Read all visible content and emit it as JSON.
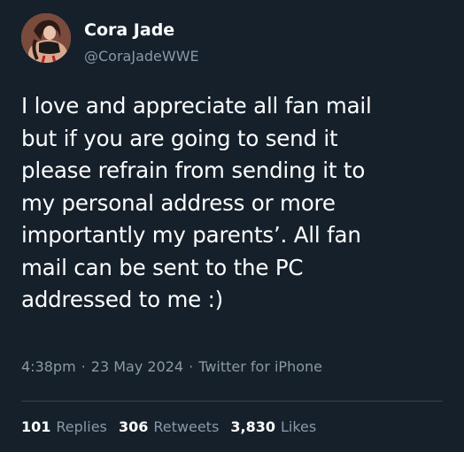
{
  "theme": {
    "background": "#15202b",
    "text_primary": "#ffffff",
    "text_secondary": "#8b98a5",
    "divider": "#38444d"
  },
  "author": {
    "name": "Cora Jade",
    "handle": "@CoraJadeWWE",
    "avatar_icon": "profile-photo"
  },
  "tweet": {
    "lines": [
      "I love and appreciate all fan mail",
      "but if you are going to send it",
      "please refrain from sending it to",
      "my personal address or more",
      "importantly my parents’. All fan",
      "mail can be sent to the PC",
      "addressed to me :)"
    ],
    "time": "4:38pm",
    "date": "23 May 2024",
    "source": "Twitter for iPhone",
    "separator": "·"
  },
  "stats": {
    "replies": {
      "count": "101",
      "label": "Replies"
    },
    "retweets": {
      "count": "306",
      "label": "Retweets"
    },
    "likes": {
      "count": "3,830",
      "label": "Likes"
    }
  }
}
